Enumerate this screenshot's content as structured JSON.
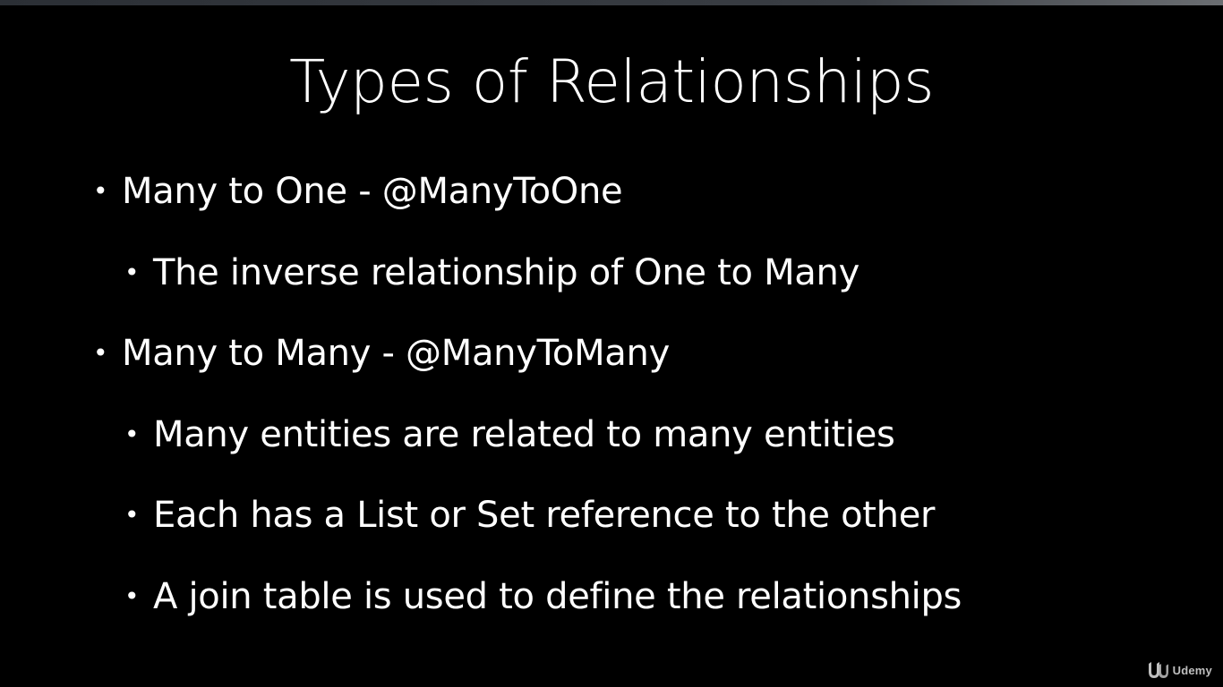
{
  "slide": {
    "title": "Types of Relationships",
    "bullets": [
      {
        "level": 1,
        "text": "Many to One - @ManyToOne"
      },
      {
        "level": 2,
        "text": "The inverse relationship of One to Many"
      },
      {
        "level": 1,
        "text": "Many to Many - @ManyToMany"
      },
      {
        "level": 2,
        "text": "Many entities are related to many entities"
      },
      {
        "level": 2,
        "text": "Each has a List or Set reference to the other"
      },
      {
        "level": 2,
        "text": "A join table is used to define the relationships"
      }
    ],
    "bullet_glyph": "•"
  },
  "watermark": {
    "text": "Udemy",
    "icon": "udemy-logo-icon"
  },
  "colors": {
    "background": "#000000",
    "text": "#ffffff",
    "watermark": "#bfbfbf"
  }
}
